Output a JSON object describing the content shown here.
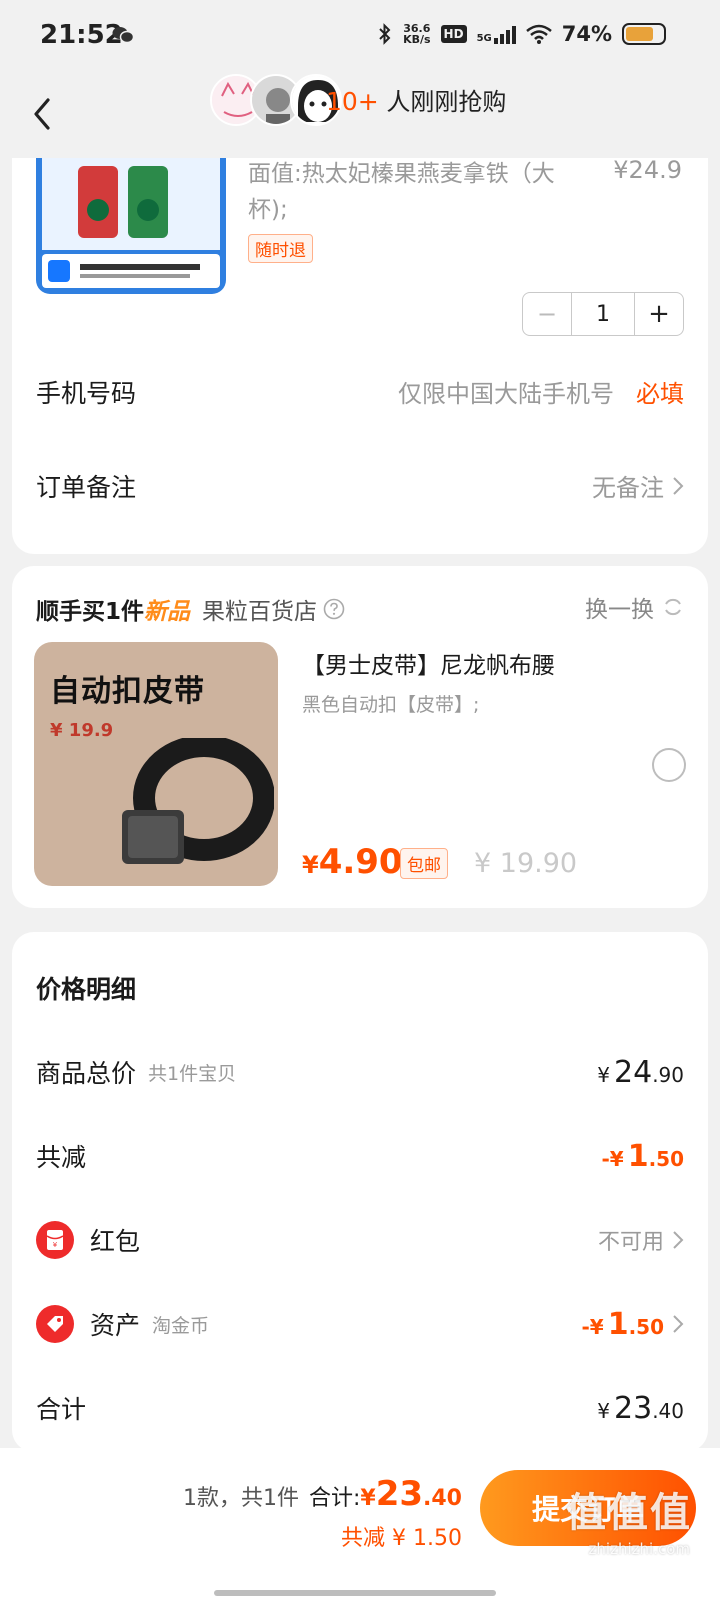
{
  "status_bar": {
    "time": "21:52",
    "net_speed_value": "36.6",
    "net_speed_unit": "KB/s",
    "hd": "HD",
    "network": "5G",
    "battery": "74%",
    "battery_level": 0.74
  },
  "nav": {
    "count": "10+",
    "text": "人刚刚抢购"
  },
  "product": {
    "title": "面值:热太妃榛果燕麦拿铁（大杯);",
    "price": "¥24.9",
    "return_tag": "随时退",
    "quantity": "1",
    "minus": "−",
    "plus": "+"
  },
  "phone_row": {
    "label": "手机号码",
    "placeholder": "仅限中国大陆手机号",
    "required": "必填"
  },
  "note_row": {
    "label": "订单备注",
    "value": "无备注"
  },
  "upsell": {
    "head_prefix": "顺手买1件",
    "head_new": "新品",
    "shop": "果粒百货店",
    "swap": "换一换",
    "image_title": "自动扣皮带",
    "image_price": "¥ 19.9",
    "title": "【男士皮带】尼龙帆布腰",
    "subtitle": "黑色自动扣【皮带】;",
    "price_yen": "¥",
    "price": "4.90",
    "free_shipping": "包邮",
    "original_price": "¥ 19.90"
  },
  "price_detail": {
    "title": "价格明细",
    "goods_total_label": "商品总价",
    "goods_total_note": "共1件宝贝",
    "goods_total_yen": "¥",
    "goods_total_int": "24",
    "goods_total_dec": ".90",
    "discount_label": "共减",
    "discount_prefix": "-¥",
    "discount_int": "1",
    "discount_dec": ".50",
    "redpacket_label": "红包",
    "redpacket_value": "不可用",
    "assets_label": "资产",
    "assets_note": "淘金币",
    "assets_prefix": "-¥",
    "assets_int": "1",
    "assets_dec": ".50",
    "sum_label": "合计",
    "sum_yen": "¥",
    "sum_int": "23",
    "sum_dec": ".40"
  },
  "bottom_bar": {
    "count_text": "1款，共1件",
    "total_label": "合计:",
    "total_yen": "¥",
    "total_int": "23",
    "total_dec": ".40",
    "discount_text": "共减 ¥ 1.50",
    "submit": "提交订单"
  },
  "watermark": {
    "main": "值值值",
    "sub": "zhizhizhi.com"
  },
  "colors": {
    "accent": "#ff5000",
    "new_tag": "#ff8c1a",
    "red_icon": "#ee2b2b"
  }
}
